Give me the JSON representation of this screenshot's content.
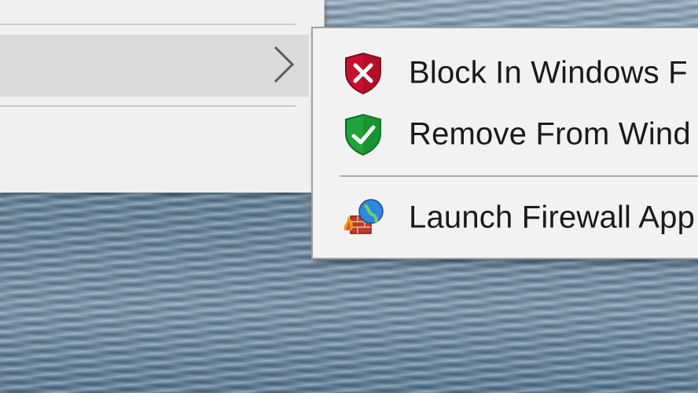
{
  "submenu": {
    "items": [
      {
        "label": "Block In Windows F",
        "icon": "red-shield-x-icon"
      },
      {
        "label": "Remove From Wind",
        "icon": "green-shield-check-icon"
      },
      {
        "label": "Launch Firewall App",
        "icon": "firewall-globe-icon"
      }
    ]
  },
  "colors": {
    "menu_bg": "#f0f0f0",
    "highlight": "#dadada",
    "shield_red": "#c8102e",
    "shield_green": "#1fa33a"
  }
}
